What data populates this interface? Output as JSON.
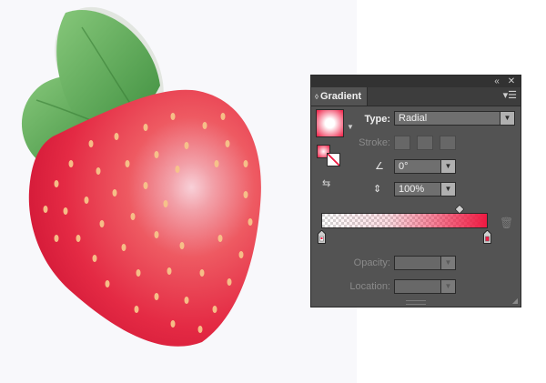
{
  "panel": {
    "collapse_icon": "double-chevron-left-icon",
    "close_icon": "close-icon",
    "tab_label": "Gradient",
    "menu_icon": "panel-menu-icon"
  },
  "gradient": {
    "type_label": "Type:",
    "type_value": "Radial",
    "stroke_label": "Stroke:",
    "angle_value": "0°",
    "aspect_value": "100%",
    "opacity_label": "Opacity:",
    "opacity_value": "",
    "location_label": "Location:",
    "location_value": "",
    "stop_color_start": "#ffffff",
    "stop_color_end": "#ee1a42",
    "stops": [
      {
        "color": "#ffffff",
        "opacity": 0,
        "location": 0
      },
      {
        "color": "#ee1a42",
        "opacity": 100,
        "location": 100
      }
    ]
  },
  "artwork": {
    "subject": "strawberry",
    "berry_color": "#e8213c",
    "leaf_color": "#5aaa52"
  }
}
